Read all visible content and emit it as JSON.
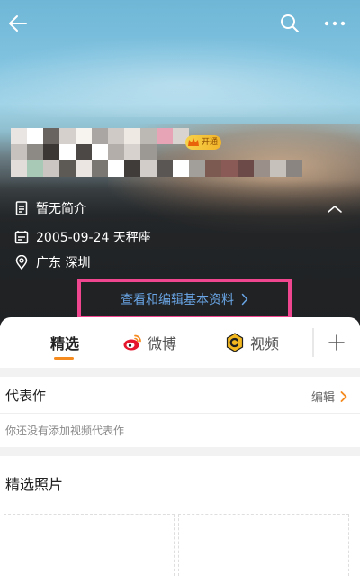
{
  "header": {
    "icons": {
      "back": "arrow-left-icon",
      "search": "search-icon",
      "more": "more-horizontal-icon"
    },
    "vip_badge": "开通",
    "profile": {
      "bio": "暂无简介",
      "birthday": "2005-09-24 天秤座",
      "location": "广东 深圳"
    },
    "edit_profile_link": "查看和编辑基本资料",
    "highlight_color": "#f0458f"
  },
  "tabs": [
    {
      "label": "精选",
      "icon": "",
      "active": true
    },
    {
      "label": "微博",
      "icon": "weibo-icon",
      "active": false
    },
    {
      "label": "视频",
      "icon": "video-channel-icon",
      "active": false
    }
  ],
  "tab_accent": "#f58a1f",
  "works": {
    "title": "代表作",
    "edit_label": "编辑",
    "empty_text": "你还没有添加视频代表作"
  },
  "photos": {
    "title": "精选照片"
  }
}
